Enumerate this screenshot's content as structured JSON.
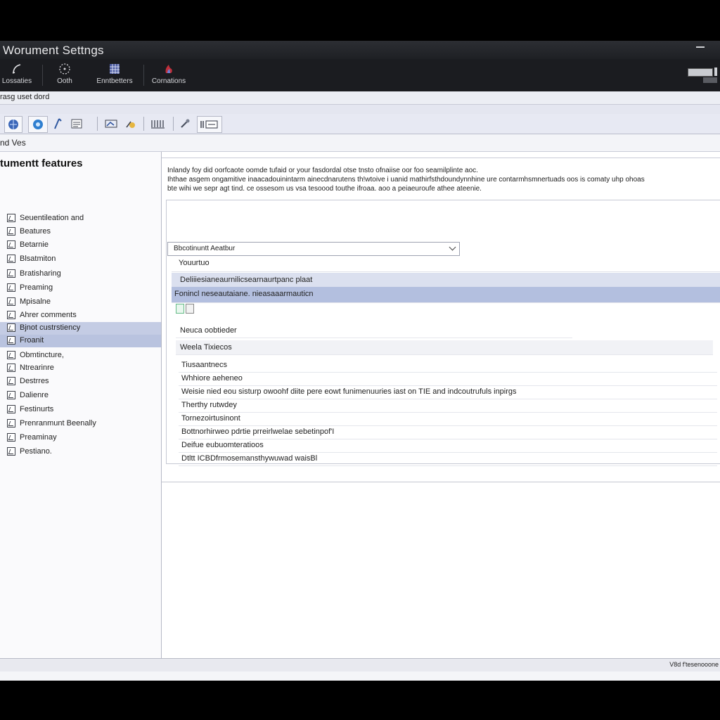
{
  "window": {
    "title": "Worument Settngs"
  },
  "ribbon": {
    "buttons": [
      {
        "label": "Lossaties",
        "icon": "pen-icon"
      },
      {
        "label": "Ooth",
        "icon": "dots-circle-icon"
      },
      {
        "label": "Enntbetters",
        "icon": "grid-icon"
      },
      {
        "label": "Cornations",
        "icon": "flame-icon"
      }
    ]
  },
  "address": {
    "text": "rasg uset dord"
  },
  "section": {
    "label": "nd Ves"
  },
  "sidebar": {
    "title": "tumentt features",
    "items": [
      {
        "label": "Seuentileation and"
      },
      {
        "label": "Beatures"
      },
      {
        "label": "Betarnie"
      },
      {
        "label": "Blsatmiton"
      },
      {
        "label": "Bratisharing"
      },
      {
        "label": "Preaming"
      },
      {
        "label": "Mpisalne"
      },
      {
        "label": "Ahrer comments"
      },
      {
        "label": "Bjnot custrstiency"
      },
      {
        "label": "Froanit"
      },
      {
        "label": "Obmtincture,"
      },
      {
        "label": "Ntrearinre"
      },
      {
        "label": "Destrres"
      },
      {
        "label": "Dalienre"
      },
      {
        "label": "Festinurts"
      },
      {
        "label": "Prenranmunt Beenally"
      },
      {
        "label": "Preaminay"
      },
      {
        "label": "Pestiano."
      }
    ]
  },
  "main": {
    "description": [
      "Inlandy foy did oorfcaote oomde tufaid or your fasdordal otse tnsto ofnaiise oor foo seamilplinte aoc.",
      "Ihthae asgem ongamitive inaacadouinintarm ainecdnarutens th!wtoive i uanid mathirfsthdoundynnhine ure contarmhsmnertuads oos is comaty uhp ohoas",
      "bte wihi we sepr agt tind. ce ossesom us vsa tesoood touthe ifroaa. aoo a peiaeuroufe athee ateenie."
    ],
    "select": {
      "value": "Bbcotinuntt Aeatbur"
    },
    "rows": [
      {
        "label": "Youurtuo"
      },
      {
        "label": "Deliiiesianeaurnilicsearnaurtpanc plaat"
      },
      {
        "label": "Fonincl neseautaiane. nieasaaarmauticn"
      }
    ],
    "fields": [
      {
        "label": "Neuca oobtieder"
      },
      {
        "label": "Weela Tixiecos"
      }
    ],
    "list": [
      {
        "label": "Tiusaantnecs"
      },
      {
        "label": "Whhiore aeheneo"
      },
      {
        "label": "Weisie nied eou sisturp owoohf diite pere eowt funimenuuries iast on TIE and indcoutrufuls inpirgs"
      },
      {
        "label": "Therthy rutwdey"
      },
      {
        "label": "Tornezoirtusinont"
      },
      {
        "label": "Bottnorhirweo pdrtie prreirlwelae sebetinpof'I"
      },
      {
        "label": "Deifue eubuomteratioos"
      },
      {
        "label": "Dtltt ICBDfrmosemansthywuwad waisBl"
      }
    ]
  },
  "statusbar": {
    "text": "V8d f'tesenooone"
  },
  "colors": {
    "selection": "#b9c3df",
    "highlight": "#b3bfdf",
    "titlebar": "#1e2024"
  }
}
